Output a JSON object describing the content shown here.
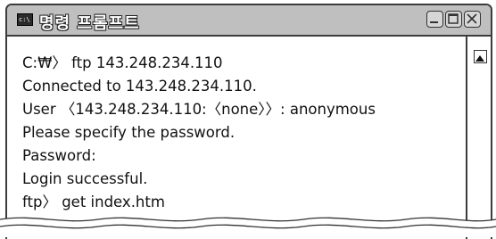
{
  "window": {
    "title": "명령 프롬프트",
    "icon_label": "c:\\"
  },
  "console": {
    "lines": [
      "C:₩〉 ftp 143.248.234.110",
      "Connected to 143.248.234.110.",
      "User 〈143.248.234.110:〈none〉〉: anonymous",
      "Please specify the password.",
      "Password:",
      "Login successful.",
      "ftp〉 get index.htm"
    ]
  },
  "icons": [
    "cmd-app-icon",
    "minimize-icon",
    "maximize-icon",
    "close-icon",
    "scroll-up-arrow-icon"
  ]
}
